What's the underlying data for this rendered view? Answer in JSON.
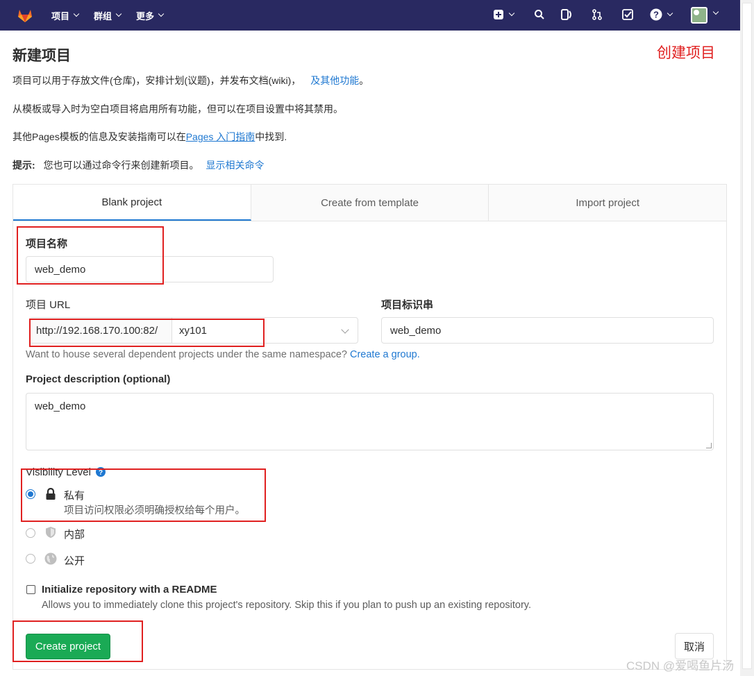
{
  "nav": {
    "items": [
      {
        "label": "项目"
      },
      {
        "label": "群组"
      },
      {
        "label": "更多"
      }
    ]
  },
  "page": {
    "title": "新建项目",
    "annotation": "创建项目",
    "intro": "项目可以用于存放文件(仓库)，安排计划(议题)，并发布文档(wiki)，",
    "intro_link": "及其他功能",
    "intro_end": "。",
    "template_note": "从模板或导入时为空白项目将启用所有功能，但可以在项目设置中将其禁用。",
    "pages_note_pre": "其他Pages模板的信息及安装指南可以在",
    "pages_note_link": "Pages 入门指南",
    "pages_note_post": "中找到.",
    "tip_label": "提示:",
    "tip_text": "您也可以通过命令行来创建新项目。",
    "tip_link": "显示相关命令"
  },
  "tabs": [
    {
      "label": "Blank project",
      "active": true
    },
    {
      "label": "Create from template",
      "active": false
    },
    {
      "label": "Import project",
      "active": false
    }
  ],
  "form": {
    "name_label": "项目名称",
    "name_value": "web_demo",
    "url_label": "项目 URL",
    "url_prefix": "http://192.168.170.100:82/",
    "url_namespace": "xy101",
    "slug_label": "项目标识串",
    "slug_value": "web_demo",
    "group_help": "Want to house several dependent projects under the same namespace?",
    "group_link": "Create a group.",
    "desc_label": "Project description (optional)",
    "desc_value": "web_demo",
    "visibility_label": "Visibility Level",
    "visibility": [
      {
        "title": "私有",
        "desc": "项目访问权限必须明确授权给每个用户。",
        "checked": true
      },
      {
        "title": "内部",
        "desc": "",
        "checked": false
      },
      {
        "title": "公开",
        "desc": "",
        "checked": false
      }
    ],
    "readme_label": "Initialize repository with a README",
    "readme_desc": "Allows you to immediately clone this project's repository. Skip this if you plan to push up an existing repository.",
    "create_button": "Create project",
    "cancel_button": "取消"
  },
  "watermark": "CSDN @爱喝鱼片汤",
  "colors": {
    "navbar": "#292961",
    "accent": "#1f78d1",
    "create": "#1aaa55",
    "annotation": "#e02020"
  }
}
